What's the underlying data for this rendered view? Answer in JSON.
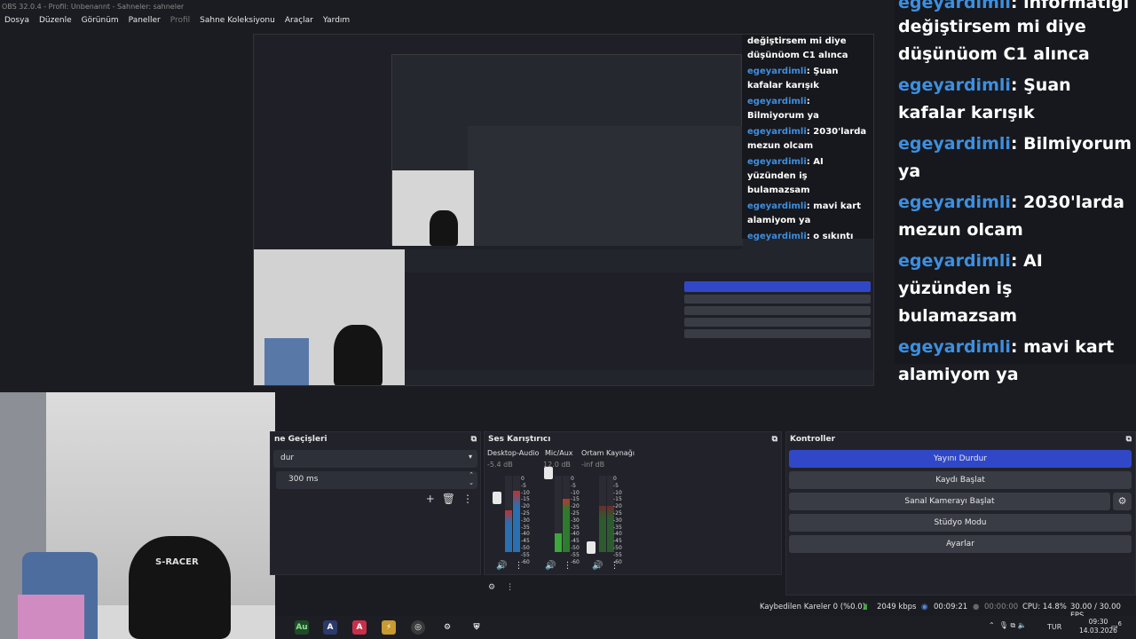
{
  "window": {
    "title": "OBS 32.0.4 - Profil: Unbenannt - Sahneler: sahneler"
  },
  "menu": [
    {
      "label": "Dosya",
      "disabled": false
    },
    {
      "label": "Düzenle",
      "disabled": false
    },
    {
      "label": "Görünüm",
      "disabled": false
    },
    {
      "label": "Paneller",
      "disabled": false
    },
    {
      "label": "Profil",
      "disabled": true
    },
    {
      "label": "Sahne Koleksiyonu",
      "disabled": false
    },
    {
      "label": "Araçlar",
      "disabled": false
    },
    {
      "label": "Yardım",
      "disabled": false
    }
  ],
  "chat": {
    "user": "egeyardimli",
    "top_partial": "değiştirsem mi diye düşünüom C1 alınca",
    "top_partial_prefix": ": informatiği",
    "messages": [
      {
        "text": ": Şuan kafalar karışık"
      },
      {
        "text": ": Bilmiyorum ya"
      },
      {
        "text": ": 2030'larda mezun olcam"
      },
      {
        "text": ": AI yüzünden iş bulamazsam"
      },
      {
        "text": ": mavi kart alamiyom ya"
      },
      {
        "text": ": o sıkıntı"
      }
    ]
  },
  "transitions": {
    "title": "Sahne Geçişleri",
    "title_visible": "ne Geçişleri",
    "selected": "dur",
    "duration": "300 ms"
  },
  "mixer": {
    "title": "Ses Karıştırıcı",
    "channels": [
      {
        "name": "Desktop-Audio",
        "db": "-5.4 dB",
        "level": 0.55
      },
      {
        "name": "Mic/Aux",
        "db": "12.0 dB",
        "level": 0.22
      },
      {
        "name": "Ortam Kaynağı",
        "db": "-inf dB",
        "level": 0.0
      }
    ],
    "scale": [
      "0",
      "-5",
      "-10",
      "-15",
      "-20",
      "-25",
      "-30",
      "-35",
      "-40",
      "-45",
      "-50",
      "-55",
      "-60"
    ]
  },
  "controls": {
    "title": "Kontroller",
    "buttons": [
      {
        "label": "Yayını Durdur",
        "primary": true
      },
      {
        "label": "Kaydı Başlat",
        "primary": false
      },
      {
        "label": "Sanal Kamerayı Başlat",
        "primary": false
      },
      {
        "label": "Stüdyo Modu",
        "primary": false
      },
      {
        "label": "Ayarlar",
        "primary": false
      }
    ]
  },
  "status": {
    "dropped": "Kaybedilen Kareler 0 (%0.0)",
    "bitrate": "2049 kbps",
    "stream_time": "00:09:21",
    "record_time": "00:00:00",
    "cpu": "CPU: 14.8%",
    "fps": "30.00 / 30.00 FPS"
  },
  "tray": {
    "lang": "TUR",
    "time": "09:30",
    "date": "14.03.2026",
    "notifications": "6"
  },
  "webcam": {
    "chair_brand": "S-RACER"
  },
  "colors": {
    "accent": "#3048c8",
    "chat_user": "#3d8fe0",
    "bg": "#1b1c22",
    "dock": "#22232a"
  }
}
